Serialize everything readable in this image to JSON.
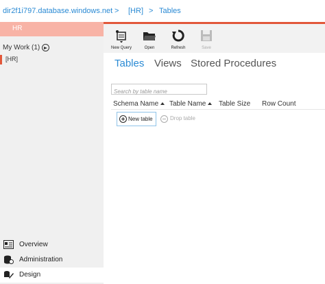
{
  "breadcrumb": {
    "server": "dir2f1i797.database.windows.net",
    "sep1": ">",
    "database": "[HR]",
    "sep2": ">",
    "page": "Tables"
  },
  "leftnav": {
    "database_header": "HR",
    "my_work_label": "My Work (1)",
    "open_item": "[HR]",
    "bottom_items": [
      {
        "label": "Overview",
        "icon": "overview-icon"
      },
      {
        "label": "Administration",
        "icon": "administration-icon"
      },
      {
        "label": "Design",
        "icon": "design-icon"
      }
    ]
  },
  "toolbar": {
    "new_query": "New Query",
    "open": "Open",
    "refresh": "Refresh",
    "save": "Save"
  },
  "tabs": [
    "Tables",
    "Views",
    "Stored Procedures"
  ],
  "active_tab": "Tables",
  "search": {
    "placeholder": "Search by table name",
    "value": ""
  },
  "table": {
    "columns": [
      "Schema Name",
      "Table Name",
      "Table Size",
      "Row Count"
    ]
  },
  "actions": {
    "new_table": "New table",
    "drop_table": "Drop table"
  },
  "colors": {
    "accent": "#e2573a",
    "link": "#2a8ad4",
    "header_bg": "#f8b3a6"
  }
}
